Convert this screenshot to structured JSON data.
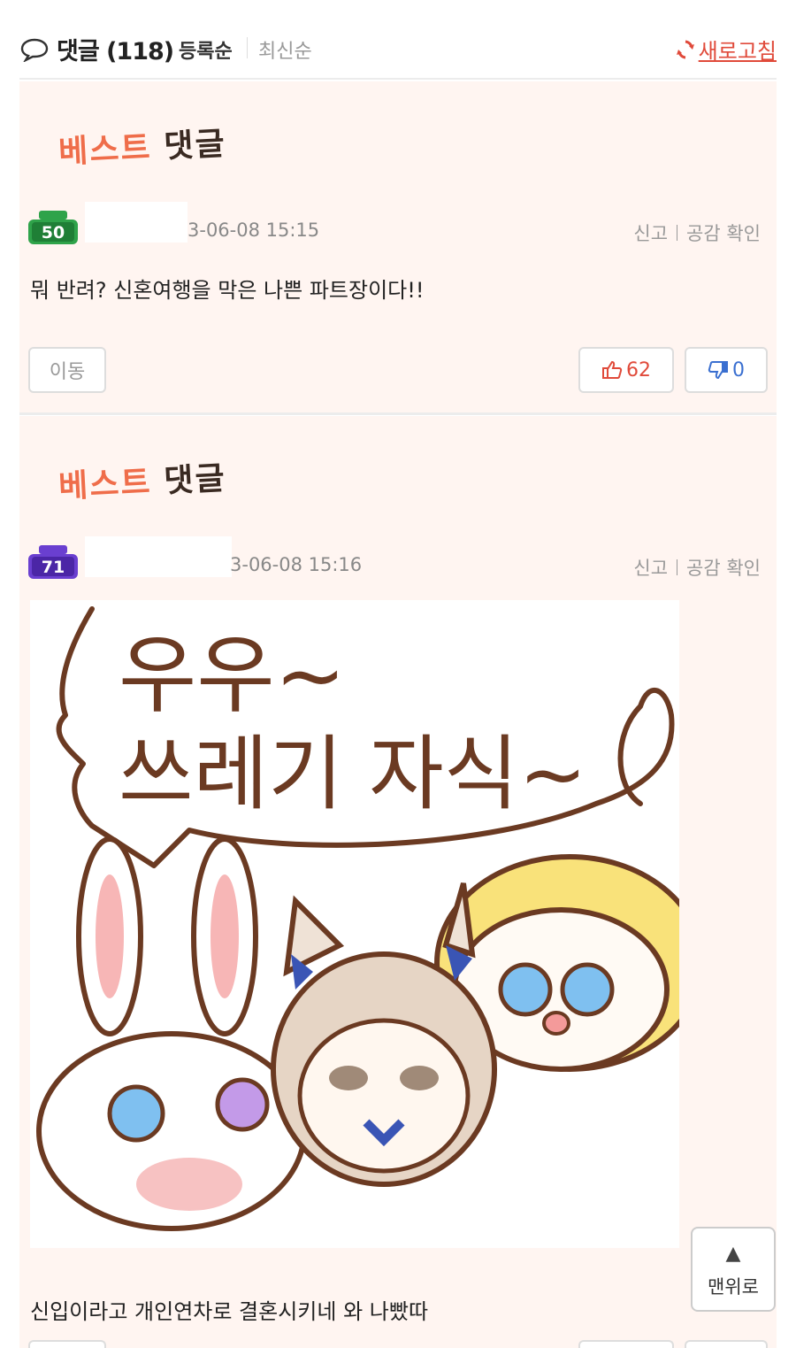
{
  "header": {
    "title": "댓글 (118)",
    "sort_registered": "등록순",
    "sort_newest": "최신순",
    "refresh_label": "새로고침"
  },
  "best_label": {
    "best": "베스트",
    "reply": "댓글"
  },
  "comments": [
    {
      "level": "50",
      "level_color": "#2fa34a",
      "date": "3-06-08 15:15",
      "report": "신고",
      "check_likes": "공감 확인",
      "text": "뭐 반려? 신혼여행을 막은 나쁜 파트장이다!!",
      "move_label": "이동",
      "likes": "62",
      "dislikes": "0"
    },
    {
      "level": "71",
      "level_color": "#6a3fd0",
      "date": "3-06-08 15:16",
      "report": "신고",
      "check_likes": "공감 확인",
      "image_text_line1": "우우~",
      "image_text_line2": "쓰레기 자식~",
      "text": "신입이라고 개인연차로 결혼시키네 와 나빴따"
    }
  ],
  "top_button": {
    "arrow": "▲",
    "label": "맨위로"
  },
  "colors": {
    "accent_red": "#e04a3a",
    "card_bg": "#fff5f1",
    "best_orange": "#ef6d4a",
    "dislike_blue": "#3a6fd0"
  }
}
